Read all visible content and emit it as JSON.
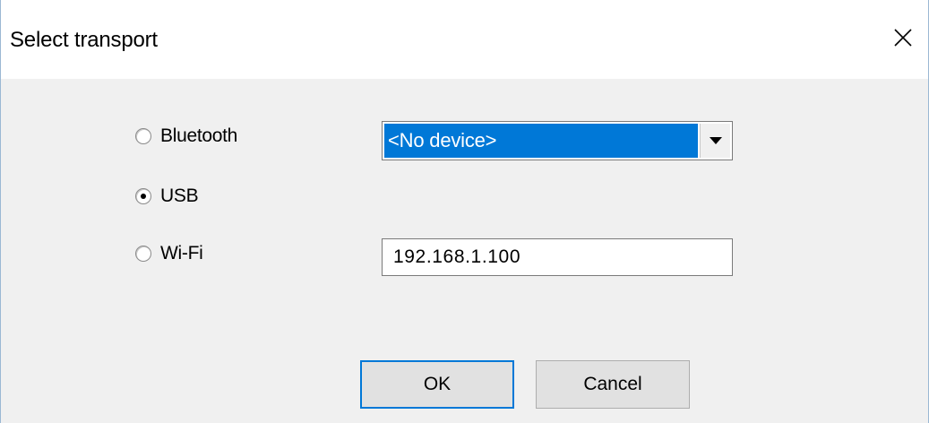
{
  "dialog": {
    "title": "Select transport",
    "close_icon": "close-icon"
  },
  "transports": [
    {
      "label": "Bluetooth",
      "checked": false
    },
    {
      "label": "USB",
      "checked": true
    },
    {
      "label": "Wi-Fi",
      "checked": false
    }
  ],
  "device_select": {
    "selected_value": "<No device>",
    "arrow_icon": "chevron-down-icon"
  },
  "wifi_address": {
    "value": "192.168.1.100"
  },
  "buttons": {
    "ok_label": "OK",
    "cancel_label": "Cancel"
  },
  "colors": {
    "selection": "#0078d7",
    "background": "#f0f0f0"
  }
}
